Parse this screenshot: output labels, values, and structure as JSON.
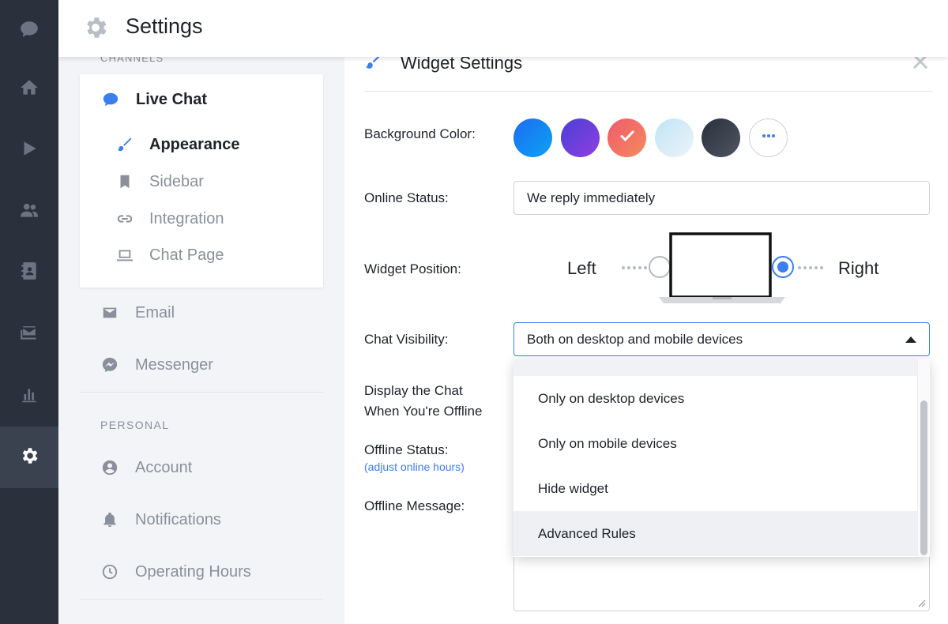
{
  "header": {
    "title": "Settings",
    "icon": "gear-icon"
  },
  "rail": {
    "items": [
      {
        "icon": "chat-bubble-icon",
        "active": false
      },
      {
        "icon": "home-icon",
        "active": false
      },
      {
        "icon": "play-icon",
        "active": false
      },
      {
        "icon": "people-icon",
        "active": false
      },
      {
        "icon": "contacts-book-icon",
        "active": false
      },
      {
        "icon": "inbox-icon",
        "active": false
      },
      {
        "icon": "bar-chart-icon",
        "active": false
      },
      {
        "icon": "gear-icon",
        "active": true
      }
    ]
  },
  "subnav": {
    "channels_title": "CHANNELS",
    "live_chat": "Live Chat",
    "appearance": "Appearance",
    "sidebar": "Sidebar",
    "integration": "Integration",
    "chat_page": "Chat Page",
    "email": "Email",
    "messenger": "Messenger",
    "personal_title": "PERSONAL",
    "account": "Account",
    "notifications": "Notifications",
    "operating_hours": "Operating Hours"
  },
  "panel": {
    "title": "Widget Settings",
    "background_color_label": "Background Color:",
    "swatches": [
      {
        "name": "blue",
        "from": "#1f6bf0",
        "to": "#0aa3f5",
        "selected": false
      },
      {
        "name": "purple",
        "from": "#4a3fd6",
        "to": "#8f3fe0",
        "selected": false
      },
      {
        "name": "coral",
        "from": "#f05a6e",
        "to": "#f58a5a",
        "selected": true
      },
      {
        "name": "light-blue",
        "from": "#bfe4f7",
        "to": "#e8f2f7",
        "selected": false
      },
      {
        "name": "dark",
        "from": "#2a303a",
        "to": "#4a5260",
        "selected": false
      }
    ],
    "online_status_label": "Online Status:",
    "online_status_value": "We reply immediately",
    "widget_position_label": "Widget Position:",
    "position_left": "Left",
    "position_right": "Right",
    "position_selected": "Right",
    "chat_visibility_label": "Chat Visibility:",
    "chat_visibility_value": "Both on desktop and mobile devices",
    "display_offline_label_1": "Display the Chat",
    "display_offline_label_2": "When You're Offline",
    "offline_status_label": "Offline Status:",
    "adjust_hours_link": "(adjust online hours)",
    "offline_message_label": "Offline Message:",
    "dropdown_options": [
      "Only on desktop devices",
      "Only on mobile devices",
      "Hide widget",
      "Advanced Rules"
    ],
    "dropdown_highlighted": "Advanced Rules"
  },
  "colors": {
    "accent": "#3b7ef0",
    "rail_bg": "#2a303c",
    "rail_active": "#3a414f"
  }
}
